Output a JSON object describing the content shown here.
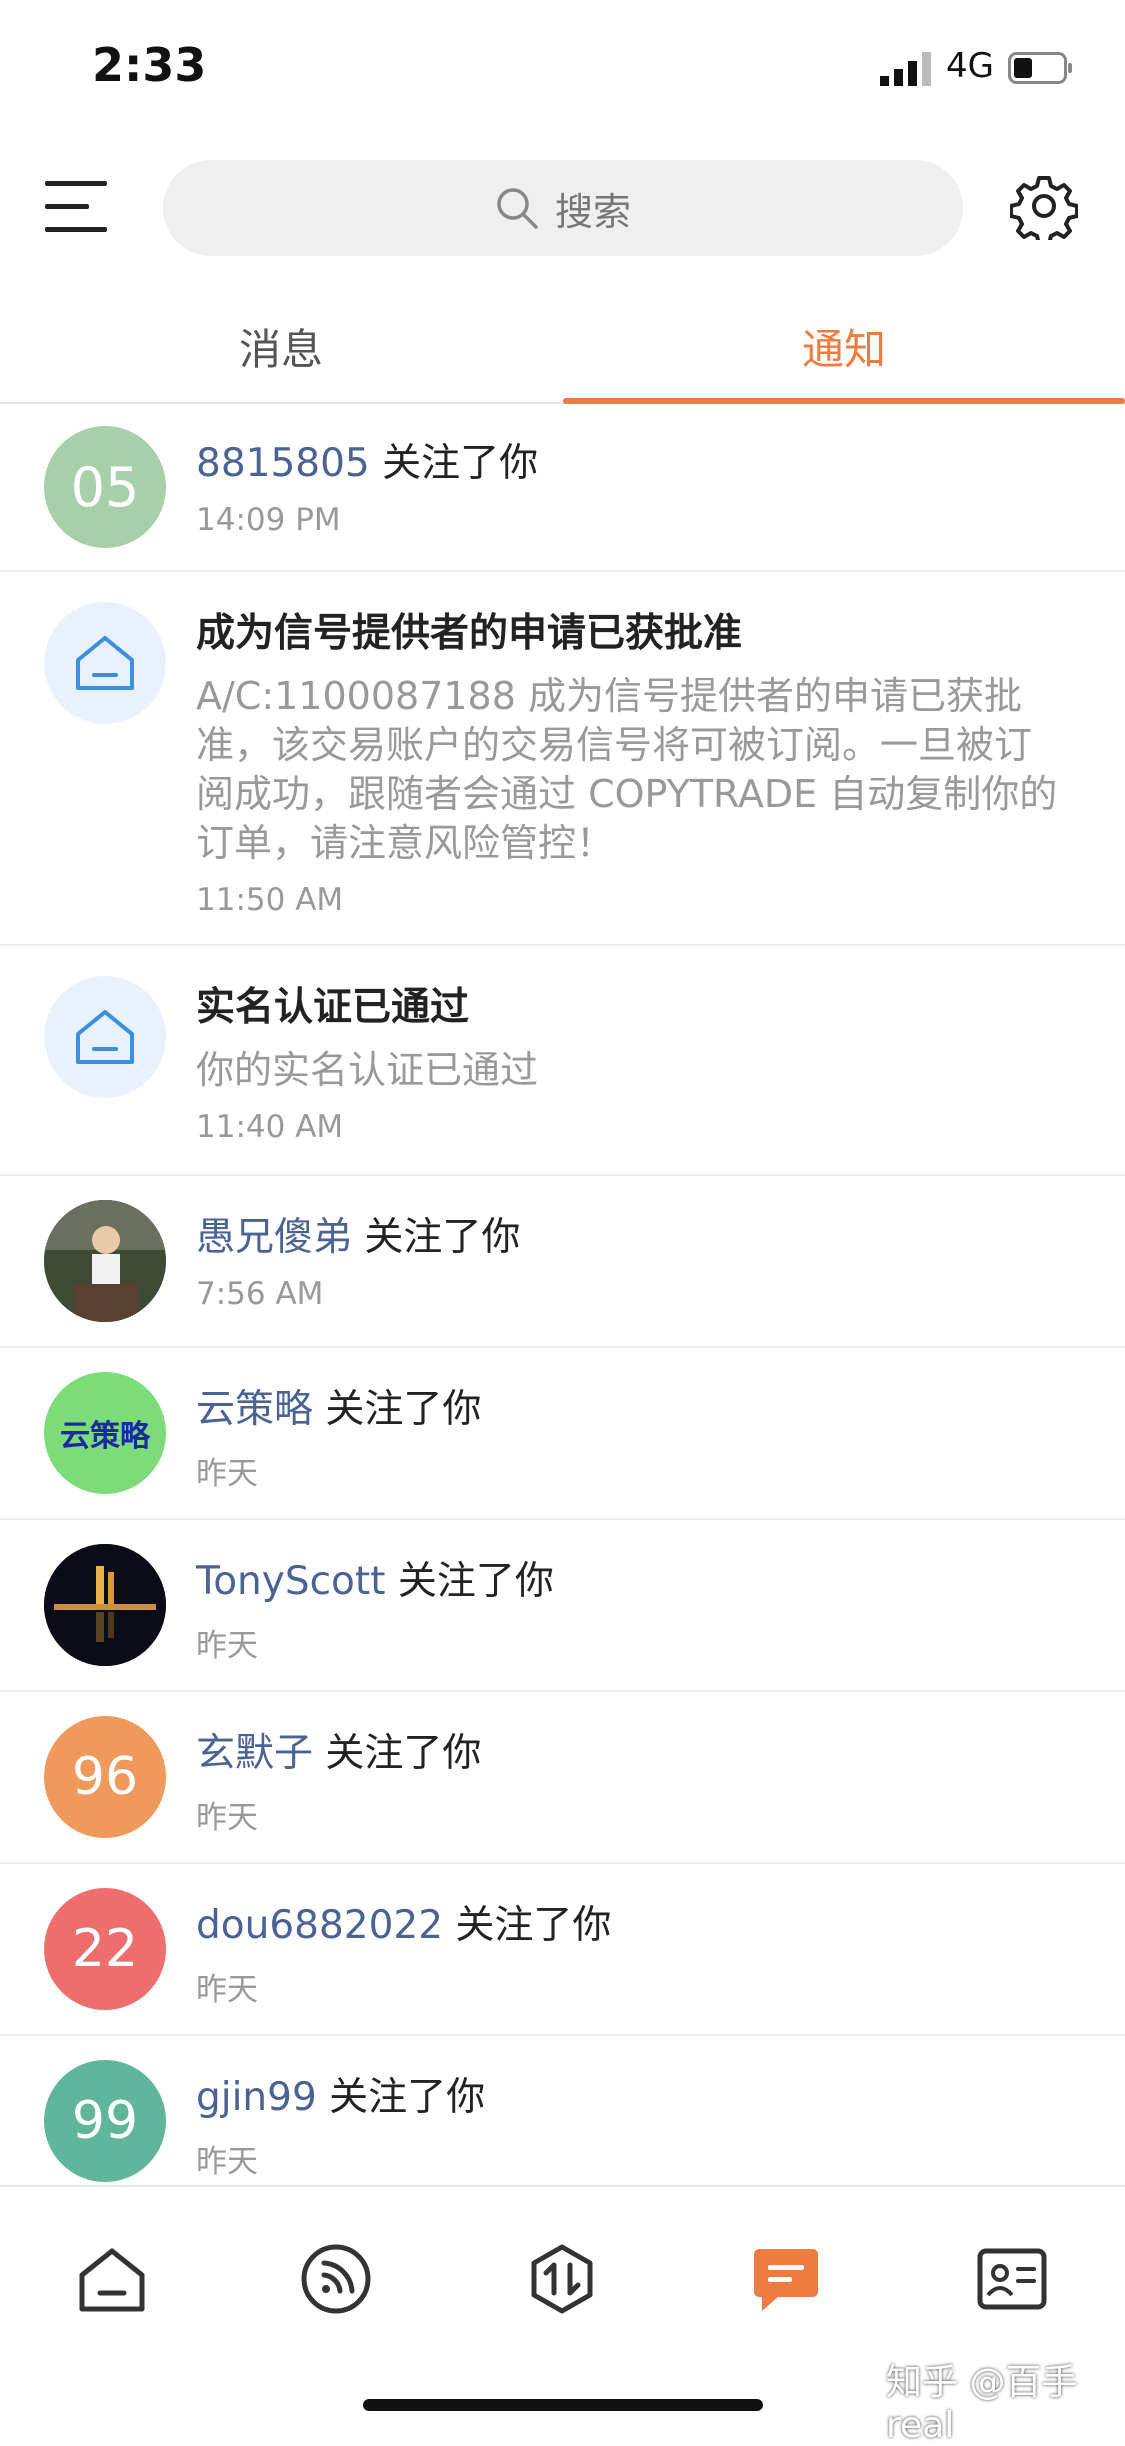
{
  "status_bar": {
    "time": "2:33",
    "network": "4G"
  },
  "header": {
    "search_placeholder": "搜索"
  },
  "tabs": [
    {
      "label": "消息",
      "active": false
    },
    {
      "label": "通知",
      "active": true
    }
  ],
  "colors": {
    "accent": "#ee7b3f",
    "username": "#4a6394"
  },
  "notifications": [
    {
      "kind": "follow",
      "avatar_text": "05",
      "avatar_color": "#a7cfaa",
      "username": "8815805",
      "action": " 关注了你",
      "time": "14:09 PM"
    },
    {
      "kind": "system",
      "avatar_icon": "house-icon",
      "title": "成为信号提供者的申请已获批准",
      "body": "A/C:1100087188 成为信号提供者的申请已获批准，该交易账户的交易信号将可被订阅。一旦被订阅成功，跟随者会通过 COPYTRADE 自动复制你的订单，请注意风险管控！",
      "time": "11:50 AM"
    },
    {
      "kind": "system",
      "avatar_icon": "house-icon",
      "title": "实名认证已通过",
      "body": "你的实名认证已通过",
      "time": "11:40 AM"
    },
    {
      "kind": "follow",
      "avatar_icon": "photo-avatar",
      "username": "愚兄傻弟",
      "action": " 关注了你",
      "time": "7:56 AM"
    },
    {
      "kind": "follow",
      "avatar_text": "云策略",
      "avatar_color": "#7ddc7a",
      "username": "云策略",
      "action": " 关注了你",
      "time": "昨天"
    },
    {
      "kind": "follow",
      "avatar_icon": "night-photo-avatar",
      "username": "TonyScott",
      "action": " 关注了你",
      "time": "昨天"
    },
    {
      "kind": "follow",
      "avatar_text": "96",
      "avatar_color": "#ef9a5c",
      "username": "玄默子",
      "action": " 关注了你",
      "time": "昨天"
    },
    {
      "kind": "follow",
      "avatar_text": "22",
      "avatar_color": "#ee6e6e",
      "username": "dou6882022",
      "action": " 关注了你",
      "time": "昨天"
    },
    {
      "kind": "follow",
      "avatar_text": "99",
      "avatar_color": "#5fb69a",
      "username": "gjin99",
      "action": " 关注了你",
      "time": "昨天"
    }
  ],
  "bottom_nav": [
    {
      "icon": "home-icon",
      "active": false
    },
    {
      "icon": "feed-icon",
      "active": false
    },
    {
      "icon": "trade-icon",
      "active": false
    },
    {
      "icon": "message-icon",
      "active": true
    },
    {
      "icon": "profile-card-icon",
      "active": false
    }
  ],
  "watermark": "知乎 @百手real"
}
